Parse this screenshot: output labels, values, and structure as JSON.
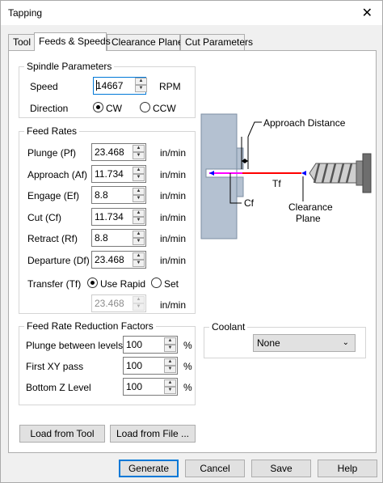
{
  "window": {
    "title": "Tapping",
    "close_glyph": "✕"
  },
  "tabs": [
    "Tool",
    "Feeds & Speeds",
    "Clearance Plane",
    "Cut Parameters"
  ],
  "spindle": {
    "group_title": "Spindle Parameters",
    "speed_label": "Speed",
    "speed_value": "14667",
    "speed_unit": "RPM",
    "direction_label": "Direction",
    "cw_label": "CW",
    "ccw_label": "CCW",
    "direction_selected": "CW"
  },
  "feed_rates": {
    "group_title": "Feed Rates",
    "rows": [
      {
        "label": "Plunge (Pf)",
        "value": "23.468",
        "unit": "in/min"
      },
      {
        "label": "Approach (Af)",
        "value": "11.734",
        "unit": "in/min"
      },
      {
        "label": "Engage (Ef)",
        "value": "8.8",
        "unit": "in/min"
      },
      {
        "label": "Cut (Cf)",
        "value": "11.734",
        "unit": "in/min"
      },
      {
        "label": "Retract (Rf)",
        "value": "8.8",
        "unit": "in/min"
      },
      {
        "label": "Departure  (Df)",
        "value": "23.468",
        "unit": "in/min"
      }
    ],
    "transfer_label": "Transfer (Tf)",
    "use_rapid_label": "Use Rapid",
    "set_label": "Set",
    "transfer_selected": "Use Rapid",
    "transfer_value": "23.468",
    "transfer_unit": "in/min"
  },
  "reduction": {
    "group_title": "Feed Rate Reduction Factors",
    "rows": [
      {
        "label": "Plunge between levels",
        "value": "100",
        "unit": "%"
      },
      {
        "label": "First XY pass",
        "value": "100",
        "unit": "%"
      },
      {
        "label": "Bottom Z Level",
        "value": "100",
        "unit": "%"
      }
    ]
  },
  "coolant": {
    "group_title": "Coolant",
    "selected": "None"
  },
  "diagram": {
    "approach_distance": "Approach Distance",
    "tf": "Tf",
    "cf": "Cf",
    "clearance_line1": "Clearance",
    "clearance_line2": "Plane"
  },
  "load_buttons": {
    "from_tool": "Load from Tool",
    "from_file": "Load from File ..."
  },
  "footer": {
    "generate": "Generate",
    "cancel": "Cancel",
    "save": "Save",
    "help": "Help"
  },
  "colors": {
    "accent": "#0078d7",
    "part_fill": "#b4c1d1",
    "tf_line": "#ff0000",
    "cf_line": "#ff00ff"
  }
}
